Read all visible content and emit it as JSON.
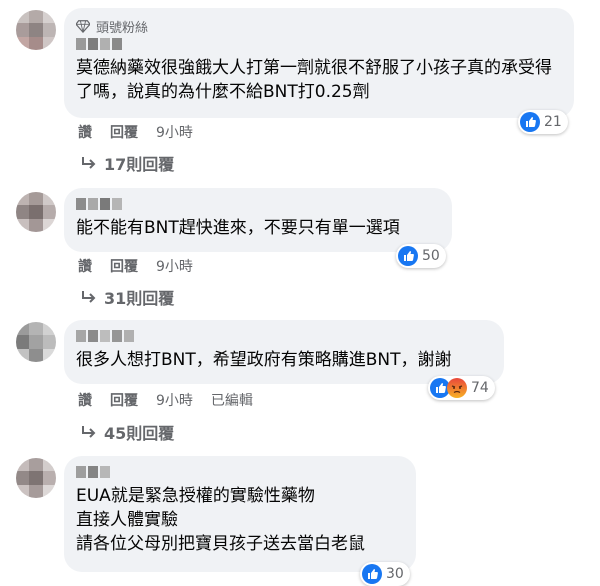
{
  "colors": {
    "like_blue": "#1877f2",
    "angry_orange": "#f0513b",
    "bubble_bg": "#f0f2f5",
    "meta_gray": "#65676b"
  },
  "comments": [
    {
      "badge": "頭號粉絲",
      "text": "莫德納藥效很強餓大人打第一劑就很不舒服了小孩子真的承受得了嗎，說真的為什麼不給BNT打0.25劑",
      "reaction_count": "21",
      "like_label": "讚",
      "reply_label": "回覆",
      "time": "9小時",
      "replies": "17則回覆"
    },
    {
      "text": "能不能有BNT趕快進來，不要只有單一選項",
      "reaction_count": "50",
      "like_label": "讚",
      "reply_label": "回覆",
      "time": "9小時",
      "replies": "31則回覆"
    },
    {
      "text": "很多人想打BNT，希望政府有策略購進BNT，謝謝",
      "reaction_count": "74",
      "like_label": "讚",
      "reply_label": "回覆",
      "time": "9小時",
      "edited": "已編輯",
      "replies": "45則回覆"
    },
    {
      "text": "EUA就是緊急授權的實驗性藥物\n直接人體實驗\n請各位父母別把寶貝孩子送去當白老鼠",
      "reaction_count": "30"
    }
  ]
}
